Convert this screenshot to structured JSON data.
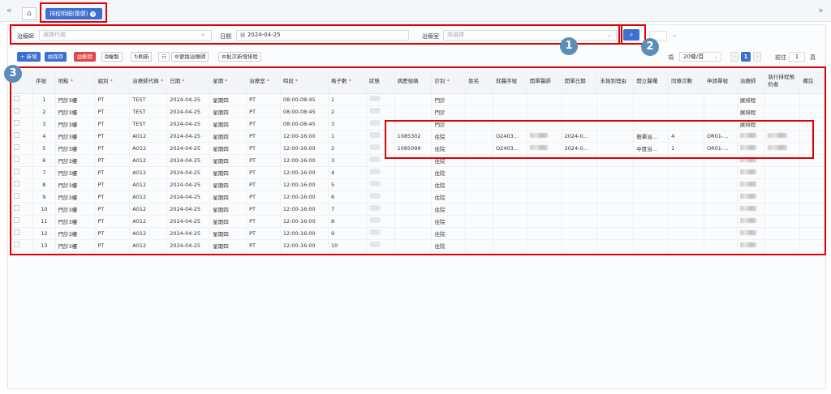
{
  "tabs": {
    "active_label": "排程明細(復健)",
    "close_icon": "×",
    "left_nav": "«",
    "right_nav": "»"
  },
  "search": {
    "therapist_label": "治療師",
    "therapist_placeholder": "選擇代碼",
    "date_label": "日期",
    "date_value": "2024-04-25",
    "room_label": "治療室",
    "room_placeholder": "請選擇"
  },
  "toolbar": {
    "add": "+ 新增",
    "save": "保存",
    "delete": "刪除",
    "copy": "複製",
    "refresh": "刷新",
    "replace": "更換治療師",
    "batch": "批次新增排程"
  },
  "pager": {
    "items_suffix": "項",
    "page_size": "20條/頁",
    "current_page": "1",
    "goto_label": "前往",
    "goto_value": "1",
    "page_suffix": "頁"
  },
  "badges": [
    "1",
    "2",
    "3"
  ],
  "columns": [
    {
      "label": "序號",
      "req": ""
    },
    {
      "label": "地點",
      "req": "*"
    },
    {
      "label": "組別",
      "req": "*"
    },
    {
      "label": "治療師代碼",
      "req": "*"
    },
    {
      "label": "日期",
      "req": "*"
    },
    {
      "label": "星期",
      "req": "*"
    },
    {
      "label": "治療室",
      "req": "*"
    },
    {
      "label": "時段",
      "req": "*"
    },
    {
      "label": "格子數",
      "req": "*"
    },
    {
      "label": "狀態",
      "req": ""
    },
    {
      "label": "病歷號碼",
      "req": ""
    },
    {
      "label": "診別",
      "req": "*"
    },
    {
      "label": "姓名",
      "req": ""
    },
    {
      "label": "就醫序號",
      "req": ""
    },
    {
      "label": "開單醫師",
      "req": ""
    },
    {
      "label": "開單日期",
      "req": ""
    },
    {
      "label": "未報到理由",
      "req": ""
    },
    {
      "label": "開立醫囑",
      "req": ""
    },
    {
      "label": "同療次數",
      "req": ""
    },
    {
      "label": "申請單號",
      "req": ""
    },
    {
      "label": "治療師",
      "req": ""
    },
    {
      "label": "執行排程預約者",
      "req": ""
    },
    {
      "label": "備註",
      "req": ""
    }
  ],
  "rows": [
    {
      "seq": "1",
      "loc": "門診3樓",
      "group": "PT",
      "code": "TEST",
      "date": "2024-04-25",
      "week": "星期四",
      "room": "PT",
      "time": "08:00-08:45",
      "cells": "1",
      "chart": "",
      "type": "門診",
      "visit": "",
      "orderdate": "",
      "order": "",
      "count": "",
      "appno": "",
      "therapist": "展排程",
      "blur_doc": false,
      "blur_ther": false,
      "blur_exec": false
    },
    {
      "seq": "2",
      "loc": "門診3樓",
      "group": "PT",
      "code": "TEST",
      "date": "2024-04-25",
      "week": "星期四",
      "room": "PT",
      "time": "08:00-08:45",
      "cells": "2",
      "chart": "",
      "type": "門診",
      "visit": "",
      "orderdate": "",
      "order": "",
      "count": "",
      "appno": "",
      "therapist": "展排程",
      "blur_doc": false,
      "blur_ther": false,
      "blur_exec": false
    },
    {
      "seq": "3",
      "loc": "門診3樓",
      "group": "PT",
      "code": "TEST",
      "date": "2024-04-25",
      "week": "星期四",
      "room": "PT",
      "time": "08:00-08:45",
      "cells": "3",
      "chart": "",
      "type": "門診",
      "visit": "",
      "orderdate": "",
      "order": "",
      "count": "",
      "appno": "",
      "therapist": "展排程",
      "blur_doc": false,
      "blur_ther": false,
      "blur_exec": false
    },
    {
      "seq": "4",
      "loc": "門診3樓",
      "group": "PT",
      "code": "A012",
      "date": "2024-04-25",
      "week": "星期四",
      "room": "PT",
      "time": "12:00-16:00",
      "cells": "1",
      "chart": "1085302",
      "type": "住院",
      "visit": "O2403...",
      "orderdate": "2024-0...",
      "order": "簡單治...",
      "count": "4",
      "appno": "OR01-...",
      "therapist": "",
      "blur_doc": true,
      "blur_ther": true,
      "blur_exec": true
    },
    {
      "seq": "5",
      "loc": "門診3樓",
      "group": "PT",
      "code": "A012",
      "date": "2024-04-25",
      "week": "星期四",
      "room": "PT",
      "time": "12:00-16:00",
      "cells": "2",
      "chart": "1085099",
      "type": "住院",
      "visit": "O2403...",
      "orderdate": "2024-0...",
      "order": "中度治...",
      "count": "1",
      "appno": "OR01-...",
      "therapist": "",
      "blur_doc": true,
      "blur_ther": true,
      "blur_exec": true
    },
    {
      "seq": "6",
      "loc": "門診3樓",
      "group": "PT",
      "code": "A012",
      "date": "2024-04-25",
      "week": "星期四",
      "room": "PT",
      "time": "12:00-16:00",
      "cells": "3",
      "chart": "",
      "type": "住院",
      "visit": "",
      "orderdate": "",
      "order": "",
      "count": "",
      "appno": "",
      "therapist": "",
      "blur_doc": false,
      "blur_ther": true,
      "blur_exec": false
    },
    {
      "seq": "7",
      "loc": "門診3樓",
      "group": "PT",
      "code": "A012",
      "date": "2024-04-25",
      "week": "星期四",
      "room": "PT",
      "time": "12:00-16:00",
      "cells": "4",
      "chart": "",
      "type": "住院",
      "visit": "",
      "orderdate": "",
      "order": "",
      "count": "",
      "appno": "",
      "therapist": "",
      "blur_doc": false,
      "blur_ther": true,
      "blur_exec": false
    },
    {
      "seq": "8",
      "loc": "門診3樓",
      "group": "PT",
      "code": "A012",
      "date": "2024-04-25",
      "week": "星期四",
      "room": "PT",
      "time": "12:00-16:00",
      "cells": "5",
      "chart": "",
      "type": "住院",
      "visit": "",
      "orderdate": "",
      "order": "",
      "count": "",
      "appno": "",
      "therapist": "",
      "blur_doc": false,
      "blur_ther": true,
      "blur_exec": false
    },
    {
      "seq": "9",
      "loc": "門診3樓",
      "group": "PT",
      "code": "A012",
      "date": "2024-04-25",
      "week": "星期四",
      "room": "PT",
      "time": "12:00-16:00",
      "cells": "6",
      "chart": "",
      "type": "住院",
      "visit": "",
      "orderdate": "",
      "order": "",
      "count": "",
      "appno": "",
      "therapist": "",
      "blur_doc": false,
      "blur_ther": true,
      "blur_exec": false
    },
    {
      "seq": "10",
      "loc": "門診3樓",
      "group": "PT",
      "code": "A012",
      "date": "2024-04-25",
      "week": "星期四",
      "room": "PT",
      "time": "12:00-16:00",
      "cells": "7",
      "chart": "",
      "type": "住院",
      "visit": "",
      "orderdate": "",
      "order": "",
      "count": "",
      "appno": "",
      "therapist": "",
      "blur_doc": false,
      "blur_ther": true,
      "blur_exec": false
    },
    {
      "seq": "11",
      "loc": "門診3樓",
      "group": "PT",
      "code": "A012",
      "date": "2024-04-25",
      "week": "星期四",
      "room": "PT",
      "time": "12:00-16:00",
      "cells": "8",
      "chart": "",
      "type": "住院",
      "visit": "",
      "orderdate": "",
      "order": "",
      "count": "",
      "appno": "",
      "therapist": "",
      "blur_doc": false,
      "blur_ther": true,
      "blur_exec": false
    },
    {
      "seq": "12",
      "loc": "門診3樓",
      "group": "PT",
      "code": "A012",
      "date": "2024-04-25",
      "week": "星期四",
      "room": "PT",
      "time": "12:00-16:00",
      "cells": "9",
      "chart": "",
      "type": "住院",
      "visit": "",
      "orderdate": "",
      "order": "",
      "count": "",
      "appno": "",
      "therapist": "",
      "blur_doc": false,
      "blur_ther": true,
      "blur_exec": false
    },
    {
      "seq": "13",
      "loc": "門診3樓",
      "group": "PT",
      "code": "A012",
      "date": "2024-04-25",
      "week": "星期四",
      "room": "PT",
      "time": "12:00-16:00",
      "cells": "10",
      "chart": "",
      "type": "住院",
      "visit": "",
      "orderdate": "",
      "order": "",
      "count": "",
      "appno": "",
      "therapist": "",
      "blur_doc": false,
      "blur_ther": true,
      "blur_exec": false
    }
  ]
}
